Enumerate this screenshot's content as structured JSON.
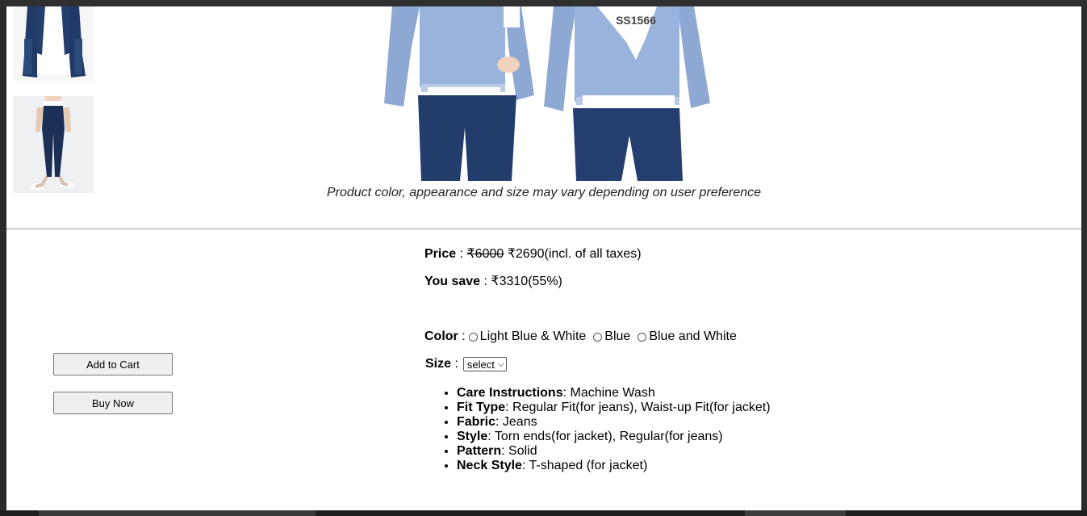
{
  "product": {
    "disclaimer": "Product color, appearance and size may vary depending on user preference",
    "image_tag_text": "SS1566"
  },
  "pricing": {
    "price_label": "Price",
    "separator": " : ",
    "original_price": "₹6000",
    "sale_price": "₹2690",
    "tax_note": "(incl. of all taxes)",
    "save_label": "You save",
    "save_amount": "₹3310(55%)"
  },
  "color": {
    "label": "Color",
    "options": [
      "Light Blue & White",
      "Blue",
      "Blue and White"
    ]
  },
  "size": {
    "label": "Size",
    "selected": "select"
  },
  "actions": {
    "add_to_cart": "Add to Cart",
    "buy_now": "Buy Now"
  },
  "details": [
    {
      "key": "Care Instructions",
      "value": ": Machine Wash"
    },
    {
      "key": "Fit Type",
      "value": ": Regular Fit(for jeans), Waist-up Fit(for jacket)"
    },
    {
      "key": "Fabric",
      "value": ": Jeans"
    },
    {
      "key": "Style",
      "value": ": Torn ends(for jacket), Regular(for jeans)"
    },
    {
      "key": "Pattern",
      "value": ": Solid"
    },
    {
      "key": "Neck Style",
      "value": ": T-shaped (for jacket)"
    }
  ]
}
